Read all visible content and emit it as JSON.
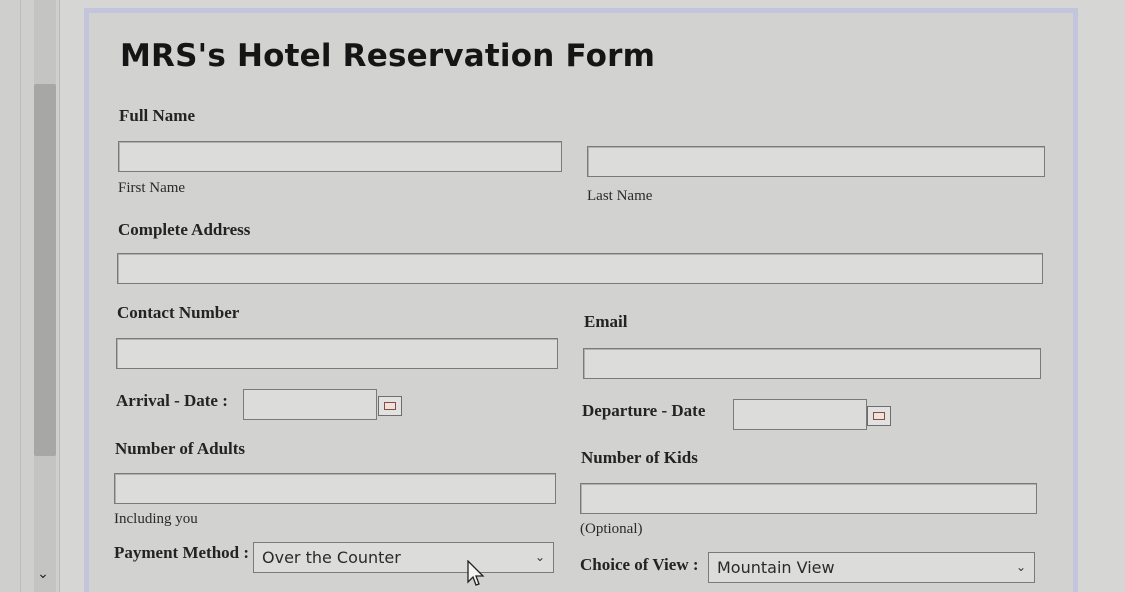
{
  "form": {
    "title": "MRS's Hotel Reservation Form",
    "full_name": {
      "label": "Full Name",
      "first_name": {
        "value": "",
        "caption": "First Name"
      },
      "last_name": {
        "value": "",
        "caption": "Last Name"
      }
    },
    "address": {
      "label": "Complete Address",
      "value": ""
    },
    "contact": {
      "label": "Contact Number",
      "value": ""
    },
    "email": {
      "label": "Email",
      "value": ""
    },
    "arrival": {
      "label": "Arrival - Date :",
      "value": ""
    },
    "departure": {
      "label": "Departure - Date",
      "value": ""
    },
    "adults": {
      "label": "Number of Adults",
      "value": "",
      "caption": "Including you"
    },
    "kids": {
      "label": "Number of Kids",
      "value": "",
      "caption": "(Optional)"
    },
    "payment": {
      "label": "Payment Method :",
      "selected": "Over the Counter"
    },
    "view": {
      "label": "Choice of View :",
      "selected": "Mountain View"
    }
  },
  "icons": {
    "calendar": "calendar-icon",
    "dropdown": "chevron-down-icon",
    "scroll_down": "scroll-down-arrow-icon",
    "pointer": "mouse-pointer-icon"
  }
}
